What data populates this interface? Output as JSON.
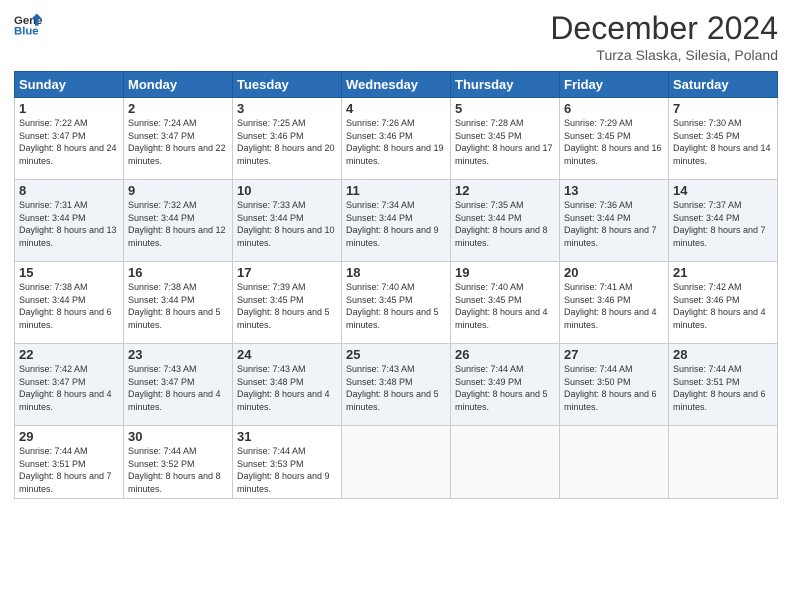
{
  "header": {
    "logo_line1": "General",
    "logo_line2": "Blue",
    "month_title": "December 2024",
    "location": "Turza Slaska, Silesia, Poland"
  },
  "weekdays": [
    "Sunday",
    "Monday",
    "Tuesday",
    "Wednesday",
    "Thursday",
    "Friday",
    "Saturday"
  ],
  "weeks": [
    [
      {
        "day": "1",
        "sunrise": "7:22 AM",
        "sunset": "3:47 PM",
        "daylight": "8 hours and 24 minutes."
      },
      {
        "day": "2",
        "sunrise": "7:24 AM",
        "sunset": "3:47 PM",
        "daylight": "8 hours and 22 minutes."
      },
      {
        "day": "3",
        "sunrise": "7:25 AM",
        "sunset": "3:46 PM",
        "daylight": "8 hours and 20 minutes."
      },
      {
        "day": "4",
        "sunrise": "7:26 AM",
        "sunset": "3:46 PM",
        "daylight": "8 hours and 19 minutes."
      },
      {
        "day": "5",
        "sunrise": "7:28 AM",
        "sunset": "3:45 PM",
        "daylight": "8 hours and 17 minutes."
      },
      {
        "day": "6",
        "sunrise": "7:29 AM",
        "sunset": "3:45 PM",
        "daylight": "8 hours and 16 minutes."
      },
      {
        "day": "7",
        "sunrise": "7:30 AM",
        "sunset": "3:45 PM",
        "daylight": "8 hours and 14 minutes."
      }
    ],
    [
      {
        "day": "8",
        "sunrise": "7:31 AM",
        "sunset": "3:44 PM",
        "daylight": "8 hours and 13 minutes."
      },
      {
        "day": "9",
        "sunrise": "7:32 AM",
        "sunset": "3:44 PM",
        "daylight": "8 hours and 12 minutes."
      },
      {
        "day": "10",
        "sunrise": "7:33 AM",
        "sunset": "3:44 PM",
        "daylight": "8 hours and 10 minutes."
      },
      {
        "day": "11",
        "sunrise": "7:34 AM",
        "sunset": "3:44 PM",
        "daylight": "8 hours and 9 minutes."
      },
      {
        "day": "12",
        "sunrise": "7:35 AM",
        "sunset": "3:44 PM",
        "daylight": "8 hours and 8 minutes."
      },
      {
        "day": "13",
        "sunrise": "7:36 AM",
        "sunset": "3:44 PM",
        "daylight": "8 hours and 7 minutes."
      },
      {
        "day": "14",
        "sunrise": "7:37 AM",
        "sunset": "3:44 PM",
        "daylight": "8 hours and 7 minutes."
      }
    ],
    [
      {
        "day": "15",
        "sunrise": "7:38 AM",
        "sunset": "3:44 PM",
        "daylight": "8 hours and 6 minutes."
      },
      {
        "day": "16",
        "sunrise": "7:38 AM",
        "sunset": "3:44 PM",
        "daylight": "8 hours and 5 minutes."
      },
      {
        "day": "17",
        "sunrise": "7:39 AM",
        "sunset": "3:45 PM",
        "daylight": "8 hours and 5 minutes."
      },
      {
        "day": "18",
        "sunrise": "7:40 AM",
        "sunset": "3:45 PM",
        "daylight": "8 hours and 5 minutes."
      },
      {
        "day": "19",
        "sunrise": "7:40 AM",
        "sunset": "3:45 PM",
        "daylight": "8 hours and 4 minutes."
      },
      {
        "day": "20",
        "sunrise": "7:41 AM",
        "sunset": "3:46 PM",
        "daylight": "8 hours and 4 minutes."
      },
      {
        "day": "21",
        "sunrise": "7:42 AM",
        "sunset": "3:46 PM",
        "daylight": "8 hours and 4 minutes."
      }
    ],
    [
      {
        "day": "22",
        "sunrise": "7:42 AM",
        "sunset": "3:47 PM",
        "daylight": "8 hours and 4 minutes."
      },
      {
        "day": "23",
        "sunrise": "7:43 AM",
        "sunset": "3:47 PM",
        "daylight": "8 hours and 4 minutes."
      },
      {
        "day": "24",
        "sunrise": "7:43 AM",
        "sunset": "3:48 PM",
        "daylight": "8 hours and 4 minutes."
      },
      {
        "day": "25",
        "sunrise": "7:43 AM",
        "sunset": "3:48 PM",
        "daylight": "8 hours and 5 minutes."
      },
      {
        "day": "26",
        "sunrise": "7:44 AM",
        "sunset": "3:49 PM",
        "daylight": "8 hours and 5 minutes."
      },
      {
        "day": "27",
        "sunrise": "7:44 AM",
        "sunset": "3:50 PM",
        "daylight": "8 hours and 6 minutes."
      },
      {
        "day": "28",
        "sunrise": "7:44 AM",
        "sunset": "3:51 PM",
        "daylight": "8 hours and 6 minutes."
      }
    ],
    [
      {
        "day": "29",
        "sunrise": "7:44 AM",
        "sunset": "3:51 PM",
        "daylight": "8 hours and 7 minutes."
      },
      {
        "day": "30",
        "sunrise": "7:44 AM",
        "sunset": "3:52 PM",
        "daylight": "8 hours and 8 minutes."
      },
      {
        "day": "31",
        "sunrise": "7:44 AM",
        "sunset": "3:53 PM",
        "daylight": "8 hours and 9 minutes."
      },
      null,
      null,
      null,
      null
    ]
  ]
}
